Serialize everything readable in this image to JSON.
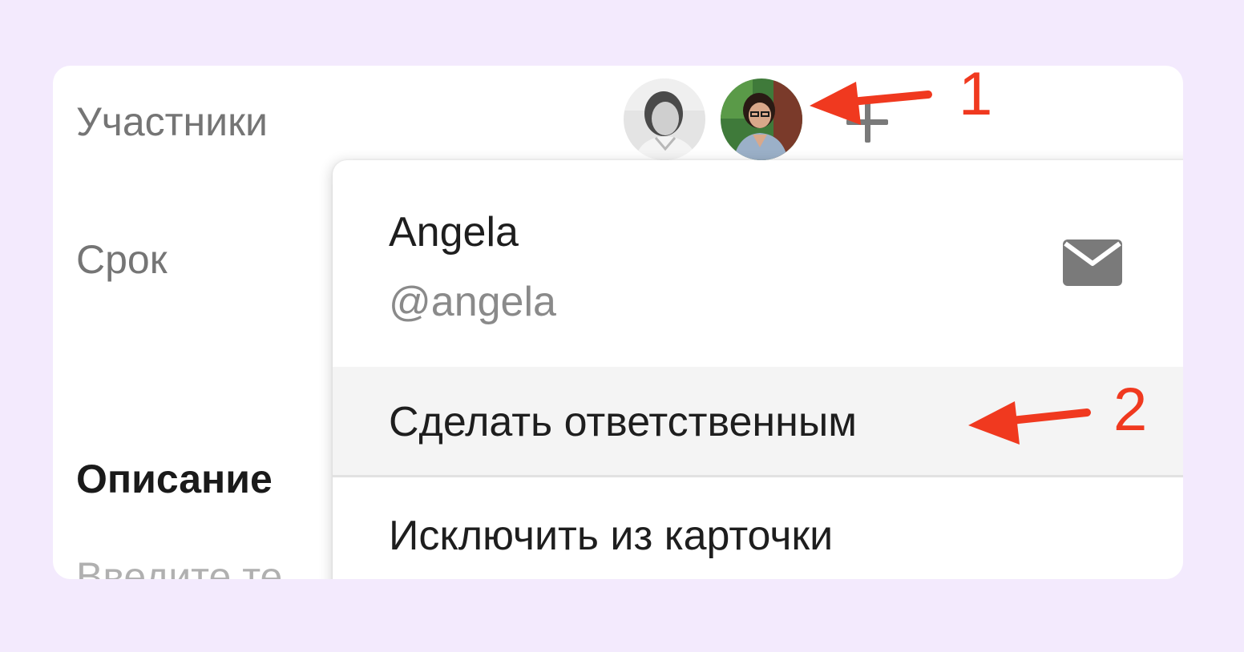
{
  "colors": {
    "page_background": "#f3eafd",
    "card_background": "#ffffff",
    "menu_highlight": "#f4f4f4",
    "annotation": "#f0391f",
    "label_text": "#757575",
    "icon": "#7a7a7a"
  },
  "card": {
    "participants_label": "Участники",
    "deadline_label": "Срок",
    "description_label": "Описание",
    "description_placeholder": "Введите те",
    "participants": [
      {
        "icon": "avatar-grayscale-photo"
      },
      {
        "icon": "avatar-color-photo",
        "selected": true
      }
    ],
    "add_participant_icon": "plus-icon"
  },
  "popup": {
    "name": "Angela",
    "handle": "@angela",
    "mail_icon": "mail-icon",
    "menu_items": [
      {
        "label": "Сделать ответственным",
        "highlighted": true
      },
      {
        "label": "Исключить из карточки",
        "highlighted": false
      }
    ]
  },
  "annotations": [
    {
      "label": "1",
      "target": "avatar-color-photo"
    },
    {
      "label": "2",
      "target": "Сделать ответственным"
    }
  ]
}
